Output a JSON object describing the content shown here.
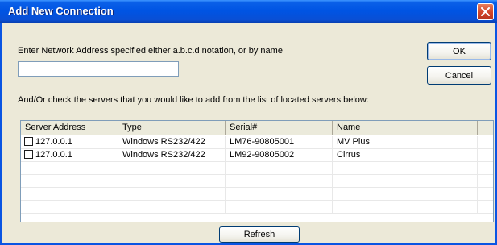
{
  "window": {
    "title": "Add New Connection"
  },
  "address": {
    "prompt": "Enter Network Address specified either a.b.c.d notation, or by name",
    "value": ""
  },
  "buttons": {
    "ok": "OK",
    "cancel": "Cancel",
    "refresh": "Refresh"
  },
  "servers": {
    "instruction": "And/Or check the servers that you would like to add from the list of located servers below:",
    "columns": [
      "Server Address",
      "Type",
      "Serial#",
      "Name"
    ],
    "rows": [
      {
        "checked": false,
        "address": "127.0.0.1",
        "type": "Windows RS232/422",
        "serial": "LM76-90805001",
        "name": "MV Plus"
      },
      {
        "checked": false,
        "address": "127.0.0.1",
        "type": "Windows RS232/422",
        "serial": "LM92-90805002",
        "name": "Cirrus"
      }
    ]
  },
  "icons": {
    "close": "close-icon",
    "checkbox": "checkbox-icon"
  },
  "colors": {
    "titlebar": "#0054e3",
    "dialog_background": "#ece9d8",
    "close_button": "#d1452a"
  }
}
